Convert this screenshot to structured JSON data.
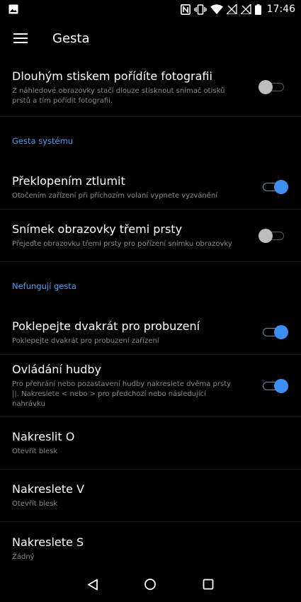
{
  "status_bar": {
    "time": "17:46",
    "icons": [
      "image-icon",
      "nfc-icon",
      "vibrate-icon",
      "wifi-icon",
      "signal-off-icon",
      "signal-off-icon",
      "battery-icon"
    ]
  },
  "app_bar": {
    "title": "Gesta",
    "menu_icon": "hamburger-menu-icon"
  },
  "settings": {
    "photo": {
      "title": "Dlouhým stiskem pořídíte fotografii",
      "subtitle": "Z náhledové obrazovky stačí dlouze stisknout snímač otisků prstů a tím pořídit fotografii.",
      "enabled": false
    },
    "section_system": "Gesta systému",
    "flip_mute": {
      "title": "Překlopením ztlumit",
      "subtitle": "Otočením zařízení při příchozím volaní vypnete vyzvánění",
      "enabled": true
    },
    "three_finger": {
      "title": "Snímek obrazovky třemi prsty",
      "subtitle": "Přejeďte obrazovku třemi prsty pro pořízení snímku obrazovky",
      "enabled": false
    },
    "section_off": "Nefungují gesta",
    "double_tap": {
      "title": "Poklepejte dvakrát pro probuzení",
      "subtitle": "Poklepejte dvakrát pro probuzení zařízení",
      "enabled": true
    },
    "music": {
      "title": "Ovládání hudby",
      "subtitle": "Pro přehrání nebo pozastavení hudby nakreslete dvěma prsty ||. Nakreslete < nebo > pro předchozí nebo následující nahrávku",
      "enabled": true
    },
    "draw_o": {
      "title": "Nakreslit O",
      "subtitle": "Otevřít blesk"
    },
    "draw_v": {
      "title": "Nakreslete V",
      "subtitle": "Otevřít blesk"
    },
    "draw_s": {
      "title": "Nakreslete S",
      "subtitle": "Žádný"
    }
  },
  "nav_bar": {
    "icons": [
      "back-icon",
      "home-icon",
      "recents-icon"
    ]
  },
  "colors": {
    "background": "#000000",
    "accent": "#4f9ff5",
    "toggle_on": "#3d8ef0",
    "toggle_off": "#bdbdbd",
    "subtitle": "#8a8a8a"
  }
}
